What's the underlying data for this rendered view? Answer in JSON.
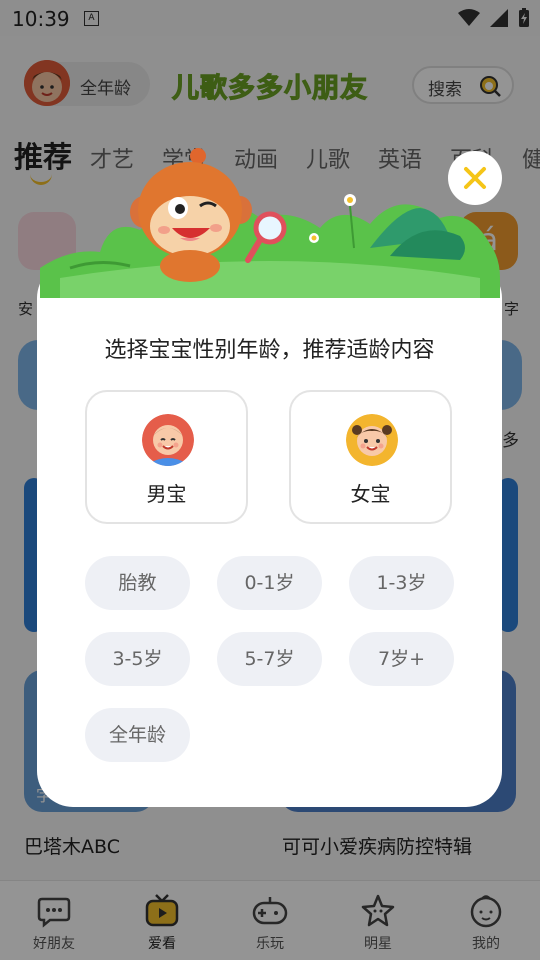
{
  "status_bar": {
    "time": "10:39",
    "notification_letter": "A"
  },
  "header": {
    "age_pill_label": "全年龄",
    "brand_title": "儿歌多多小朋友",
    "search_label": "搜索"
  },
  "tabs": [
    "推荐",
    "才艺",
    "学堂",
    "动画",
    "儿歌",
    "英语",
    "百科",
    "健"
  ],
  "background": {
    "icon_labels": [
      "安",
      "字"
    ],
    "side_text": "多",
    "icon_letter": "á",
    "card_titles": [
      "巴塔木ABC",
      "可可小爱疾病防控特辑"
    ],
    "card_tag": "字"
  },
  "bottom_nav": [
    {
      "label": "好朋友",
      "icon": "chat-bubble-icon"
    },
    {
      "label": "爱看",
      "icon": "tv-icon"
    },
    {
      "label": "乐玩",
      "icon": "gamepad-icon"
    },
    {
      "label": "明星",
      "icon": "star-icon"
    },
    {
      "label": "我的",
      "icon": "baby-face-icon"
    }
  ],
  "dialog": {
    "title": "选择宝宝性别年龄，推荐适龄内容",
    "gender_options": [
      {
        "label": "男宝",
        "avatar": "boy-avatar-icon"
      },
      {
        "label": "女宝",
        "avatar": "girl-avatar-icon"
      }
    ],
    "age_options": [
      "胎教",
      "0-1岁",
      "1-3岁",
      "3-5岁",
      "5-7岁",
      "7岁+",
      "全年龄"
    ],
    "close_icon": "close-icon"
  },
  "colors": {
    "brand_green": "#8cc63f",
    "accent_yellow": "#f3c02c",
    "close_x": "#f5c518",
    "overlay": "rgba(0,0,0,0.42)",
    "age_button_bg": "#eef0f5"
  }
}
